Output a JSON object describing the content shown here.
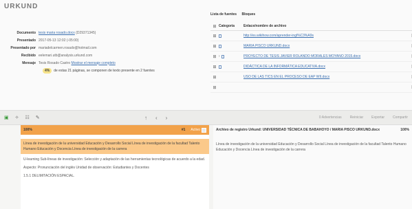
{
  "app": {
    "brand": "URKUND"
  },
  "meta": {
    "rows": [
      {
        "key": "Documento",
        "value": "tesis maria rosado.docx",
        "extra": "(D29371345)"
      },
      {
        "key": "Presentado",
        "value": "2017-05-13 12:02 (-05:00)",
        "extra": ""
      },
      {
        "key": "Presentado por",
        "value": "mariadelcarmen.rosado@hotmail.com",
        "extra": ""
      },
      {
        "key": "Recibido",
        "value": "eelemari.utb@analysis.urkund.com",
        "extra": ""
      },
      {
        "key": "Mensaje",
        "value": "Tesis Rosado Castro",
        "extra": "Mostrar el mensaje completo"
      }
    ],
    "percent": "4%",
    "percent_note": "de estas 21 páginas, se componen de texto presente en 2 fuentes"
  },
  "sources": {
    "title": "Lista de fuentes",
    "tab": "Bloques",
    "col_category": "Categoría",
    "col_link": "Enlace/nombre de archivo",
    "items": [
      {
        "name": "http://es.wikihow.com/aprender-ingl%C3%A9s"
      },
      {
        "name": "MARIA PISCO URKUND.docx"
      },
      {
        "name": "PROYECTO DE TESIS JAVIER ROLANDO MORALES MOYANO 2015.docx"
      },
      {
        "name": "DIDÁCTICA DE LA INFORMÁTICA EDUCATIVA.docx"
      },
      {
        "name": "USO DE LAS TICS EN EL PROCESO DE EAP WII.docx"
      },
      {
        "name": ""
      }
    ]
  },
  "toolbar": {
    "advertencias": "0 Advertencias",
    "reiniciar": "Reiniciar",
    "exportar": "Exportar",
    "compartir": "Compartir"
  },
  "left_pane": {
    "percent": "100%",
    "counter": "#1",
    "active_label": "Activo",
    "highlight": "Línea de investigación de la universidad Educación y Desarrollo Social Línea de investigación de la facultad Talento Humano Educación y Docencia Línea de investigación de la carrera",
    "p1": "U-learning Sub-líneas de investigación: Selección y adaptación de las herramientas tecnológicas de acuerdo a la edad.",
    "p2": "Aspecto: Pronunciación del inglés Unidad de observación: Estudiantes y Docentes",
    "p3": "1.5.1 DELIMITACIÓN ESPACIAL."
  },
  "right_pane": {
    "title": "Archivo de registro Urkund: UNIVERSIDAD TÉCNICA DE BABAHOYO / MARIA PISCO URKUND.docx",
    "percent": "100%",
    "text": "Línea de investigación de la universidad Educación y Desarrollo Social Línea de investigación de la facultad Talento Humano Educación y Docencia Línea de investigación de la carrera"
  }
}
